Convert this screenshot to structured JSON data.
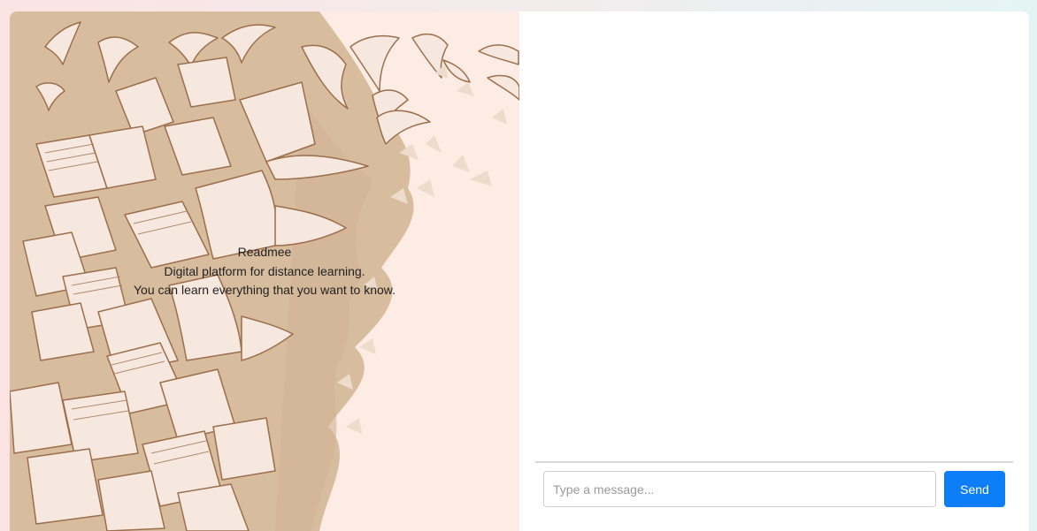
{
  "intro": {
    "title": "Readmee",
    "line1": "Digital platform for distance learning.",
    "line2": "You can learn everything that you want to know."
  },
  "chat": {
    "input_placeholder": "Type a message...",
    "input_value": "",
    "send_label": "Send"
  },
  "colors": {
    "accent": "#0d7df8",
    "panel_background": "#fdece3",
    "illustration_shadow": "#d8bc9e",
    "illustration_stroke": "#9b6e4c",
    "illustration_fill": "#f6e8de"
  }
}
